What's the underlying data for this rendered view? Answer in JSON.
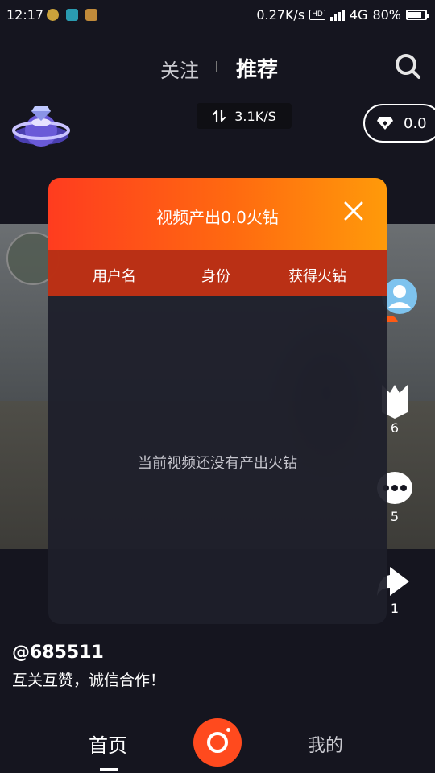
{
  "status_bar": {
    "time": "12:17",
    "net_speed": "0.27K/s",
    "hd": "HD",
    "network": "4G",
    "battery": "80%",
    "battery_level": 0.8
  },
  "top_tabs": {
    "follow": "关注",
    "recommend": "推荐"
  },
  "speed_chip": {
    "value": "3.1K/S"
  },
  "diamond": {
    "value": "0.0"
  },
  "modal": {
    "title": "视频产出0.0火钻",
    "columns": [
      "用户名",
      "身份",
      "获得火钻"
    ],
    "empty_text": "当前视频还没有产出火钻"
  },
  "actions": {
    "likes": "6",
    "comments": "5",
    "shares": "1"
  },
  "post": {
    "username": "@685511",
    "caption": "互关互赞，诚信合作！"
  },
  "bottom_nav": {
    "home": "首页",
    "mine": "我的"
  },
  "colors": {
    "accent": "#ff5a14",
    "background": "#15151f"
  }
}
